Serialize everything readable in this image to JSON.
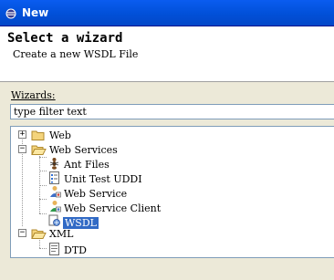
{
  "window": {
    "title": "New"
  },
  "header": {
    "title": "Select a wizard",
    "description": "Create a new WSDL File"
  },
  "wizards": {
    "label": "Wizards:",
    "filter_value": "type filter text"
  },
  "tree": {
    "items": [
      {
        "label": "Web",
        "expanded": false
      },
      {
        "label": "Web Services",
        "expanded": true
      },
      {
        "label": "Ant Files"
      },
      {
        "label": "Unit Test UDDI"
      },
      {
        "label": "Web Service"
      },
      {
        "label": "Web Service Client"
      },
      {
        "label": "WSDL",
        "selected": true
      },
      {
        "label": "XML",
        "expanded": true
      },
      {
        "label": "DTD"
      }
    ]
  },
  "colors": {
    "titlebar": "#0454e1",
    "selection": "#316ac5",
    "folder": "#f4d47c"
  }
}
